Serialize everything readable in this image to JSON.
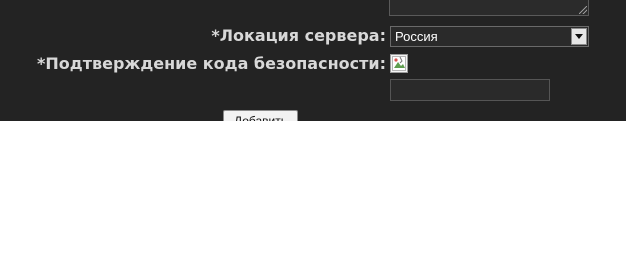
{
  "form": {
    "server_location_label": "*Локация сервера:",
    "server_location_value": "Россия",
    "captcha_label": "*Подтверждение кода безопасности:",
    "captcha_input_value": "",
    "submit_label": "Добавить"
  },
  "icons": {
    "select_arrow": "chevron-down-icon",
    "captcha": "broken-image-icon",
    "resize": "resize-grip-icon"
  },
  "colors": {
    "panel_background": "#232323",
    "label_text": "#d8d8d8",
    "page_background": "#ffffff"
  }
}
